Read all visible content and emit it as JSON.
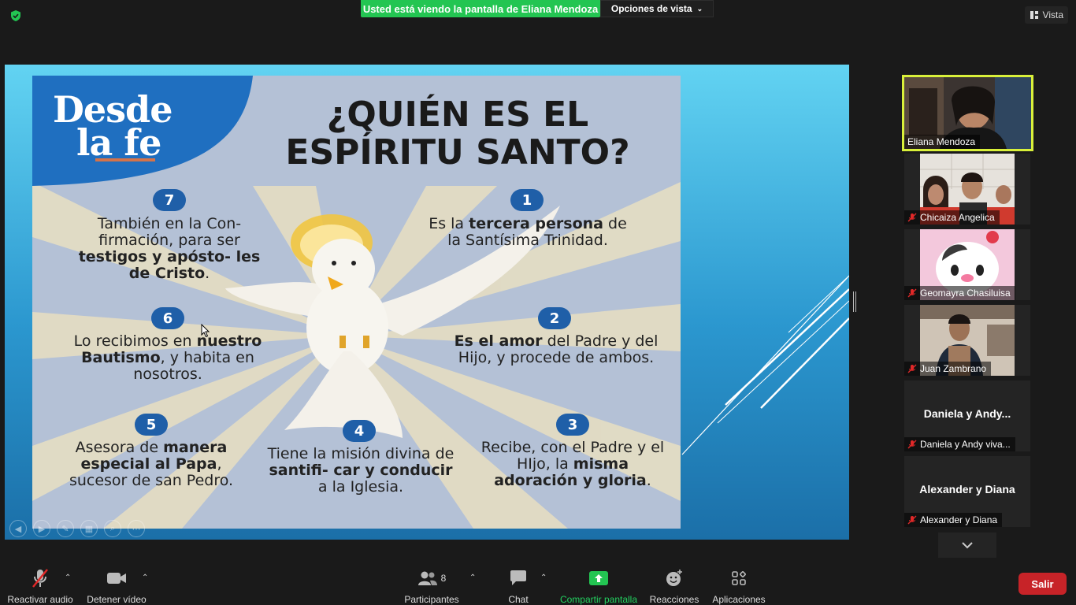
{
  "meeting": {
    "banner": "Usted está viendo la pantalla de Eliana Mendoza",
    "view_options": "Opciones de vista",
    "vista": "Vista"
  },
  "slide": {
    "logo_line1": "Desde",
    "logo_line2": "la fe",
    "title_line1": "¿QUIÉN ES EL",
    "title_line2": "ESPÍRITU SANTO?",
    "items": [
      {
        "num": "1",
        "pre": "Es la ",
        "bold": "tercera persona",
        "post": " de la Santísima Trinidad."
      },
      {
        "num": "2",
        "pre": "",
        "bold": "Es el amor",
        "post": " del Padre y del Hijo, y procede de ambos."
      },
      {
        "num": "3",
        "pre": "Recibe, con el Padre y el HIjo, la ",
        "bold": "misma adoración y gloria",
        "post": "."
      },
      {
        "num": "4",
        "pre": "Tiene la misión divina de ",
        "bold": "santifi- car y conducir",
        "post": " a la Iglesia."
      },
      {
        "num": "5",
        "pre": "Asesora de ",
        "bold": "manera especial al Papa",
        "post": ", sucesor de san Pedro."
      },
      {
        "num": "6",
        "pre": "Lo recibimos en ",
        "bold": "nuestro Bautismo",
        "post": ", y habita en nosotros."
      },
      {
        "num": "7",
        "pre": "También en la Con- firmación, para ser ",
        "bold": "testigos y apósto- les de Cristo",
        "post": "."
      }
    ]
  },
  "participants": [
    {
      "name": "Eliana Mendoza",
      "muted": false,
      "video": true
    },
    {
      "name": "Chicaiza Angelica",
      "muted": true,
      "video": true
    },
    {
      "name": "Geomayra Chasiluisa",
      "muted": true,
      "video": true
    },
    {
      "name": "Juan Zambrano",
      "muted": true,
      "video": true
    },
    {
      "name": "Daniela y  Andy  viva...",
      "big": "Daniela y   Andy...",
      "muted": true,
      "video": false
    },
    {
      "name": "Alexander y Diana",
      "big": "Alexander y Diana",
      "muted": true,
      "video": false
    }
  ],
  "toolbar": {
    "audio": "Reactivar audio",
    "video": "Detener vídeo",
    "participants": "Participantes",
    "participants_count": "8",
    "chat": "Chat",
    "share": "Compartir pantalla",
    "reactions": "Reacciones",
    "apps": "Aplicaciones",
    "leave": "Salir"
  },
  "colors": {
    "banner_green": "#23c552",
    "active_speaker": "#d9f03a",
    "leave_red": "#c72328",
    "share_green": "#23d160"
  }
}
